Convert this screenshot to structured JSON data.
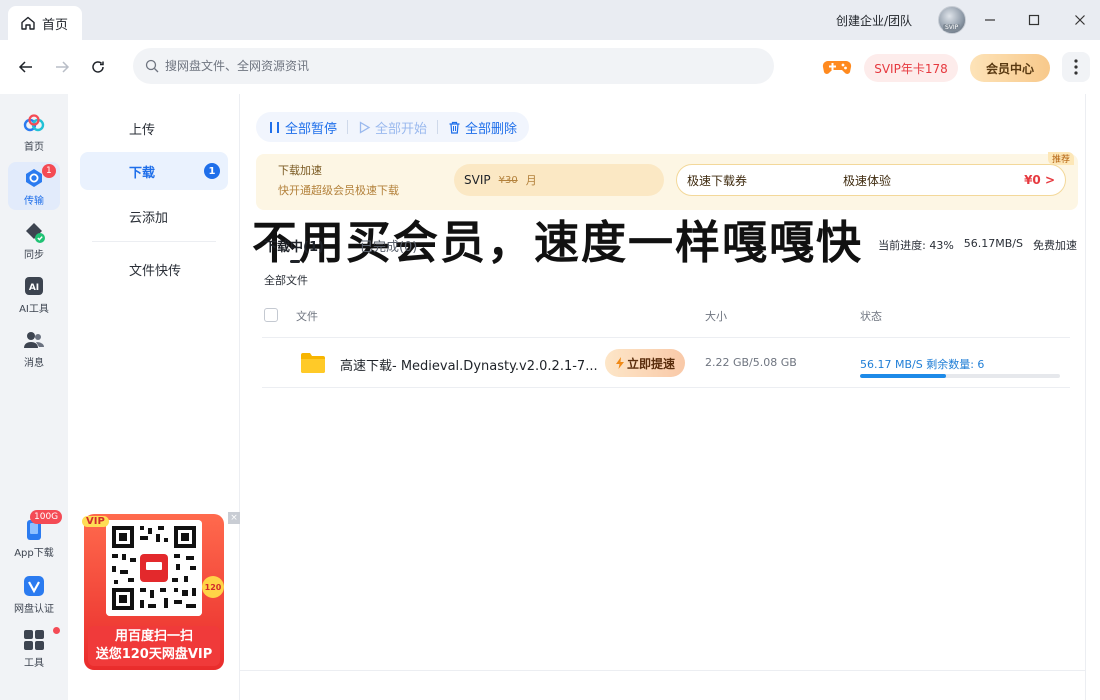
{
  "titlebar": {
    "home_tab": "首页",
    "enterprise_link": "创建企业/团队",
    "avatar_text": "SVIP"
  },
  "navbar": {
    "search_placeholder": "搜网盘文件、全网资源资讯",
    "svip_offer": "SVIP年卡178",
    "member_center": "会员中心"
  },
  "rail": {
    "items": [
      {
        "label": "首页",
        "icon": "cloud-logo-icon"
      },
      {
        "label": "传输",
        "icon": "transfer-icon",
        "badge": "1"
      },
      {
        "label": "同步",
        "icon": "sync-icon"
      },
      {
        "label": "AI工具",
        "icon": "ai-tools-icon"
      },
      {
        "label": "消息",
        "icon": "message-icon"
      },
      {
        "label": "App下载",
        "icon": "phone-icon",
        "badge": "100G"
      },
      {
        "label": "网盘认证",
        "icon": "verify-icon"
      },
      {
        "label": "工具",
        "icon": "tools-grid-icon"
      }
    ]
  },
  "subside": {
    "items": [
      {
        "label": "上传"
      },
      {
        "label": "下载",
        "badge": "1"
      },
      {
        "label": "云添加"
      },
      {
        "label": "文件快传"
      }
    ]
  },
  "ad": {
    "vip_tag": "VIP",
    "count_tag": "120",
    "text_line1": "用百度扫一扫",
    "text_line2": "送您120天网盘VIP",
    "close": "×"
  },
  "toolbar": {
    "pause_all": "全部暂停",
    "start_all": "全部开始",
    "delete_all": "全部删除"
  },
  "promo": {
    "tag": "推荐",
    "line1": "下载加速",
    "line2": "快开通超级会员极速下载",
    "card1_price": "¥30",
    "card1_unit": "月",
    "card1_label": "SVIP",
    "card2_left": "极速下载券",
    "card2_right": "极速体验",
    "card2_price": "¥0",
    "overlay": "不用买会员，速度一样嘎嘎快"
  },
  "tabs": {
    "downloading": "下载中(1)",
    "completed": "已完成(0)"
  },
  "progress_info": {
    "label": "当前进度:",
    "percent": "43%",
    "speed": "56.17MB/S",
    "free_boost": "免费加速"
  },
  "all_files": "全部文件",
  "table": {
    "headers": {
      "file": "文件",
      "size": "大小",
      "status": "状态"
    },
    "rows": [
      {
        "name": "高速下载- Medieval.Dynasty.v2.0.2.1-7...",
        "boost": "立即提速",
        "size": "2.22 GB/5.08 GB",
        "status": "56.17 MB/S 剩余数量: 6",
        "progress": 0.43
      }
    ]
  },
  "colors": {
    "accent": "#1f6fea",
    "danger": "#f44b55",
    "progress": "#1d8ae8"
  }
}
